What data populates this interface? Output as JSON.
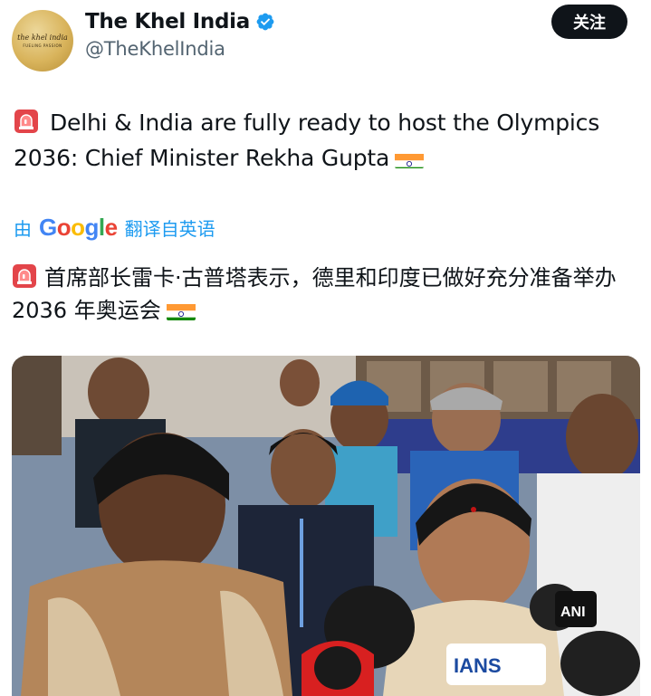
{
  "author": {
    "display_name": "The Khel India",
    "handle": "@TheKhelIndia",
    "avatar_logo_text": "the khel india",
    "avatar_tagline": "FUELING PASSION"
  },
  "follow_button": {
    "label": "关注"
  },
  "tweet": {
    "text": "Delhi & India are fully ready to host the Olympics 2036: Chief Minister Rekha Gupta"
  },
  "translation": {
    "prefix": "由",
    "provider": "Google",
    "link_label": "翻译自英语",
    "text": "首席部长雷卡·古普塔表示，德里和印度已做好充分准备举办 2036 年奥运会"
  },
  "media": {
    "mic_labels": [
      "IANS",
      "ANI"
    ]
  },
  "colors": {
    "accent": "#1d9bf0",
    "text": "#0f1419",
    "secondary": "#536471"
  },
  "icons": [
    "verified-badge-icon",
    "siren-emoji-icon",
    "india-flag-icon"
  ]
}
